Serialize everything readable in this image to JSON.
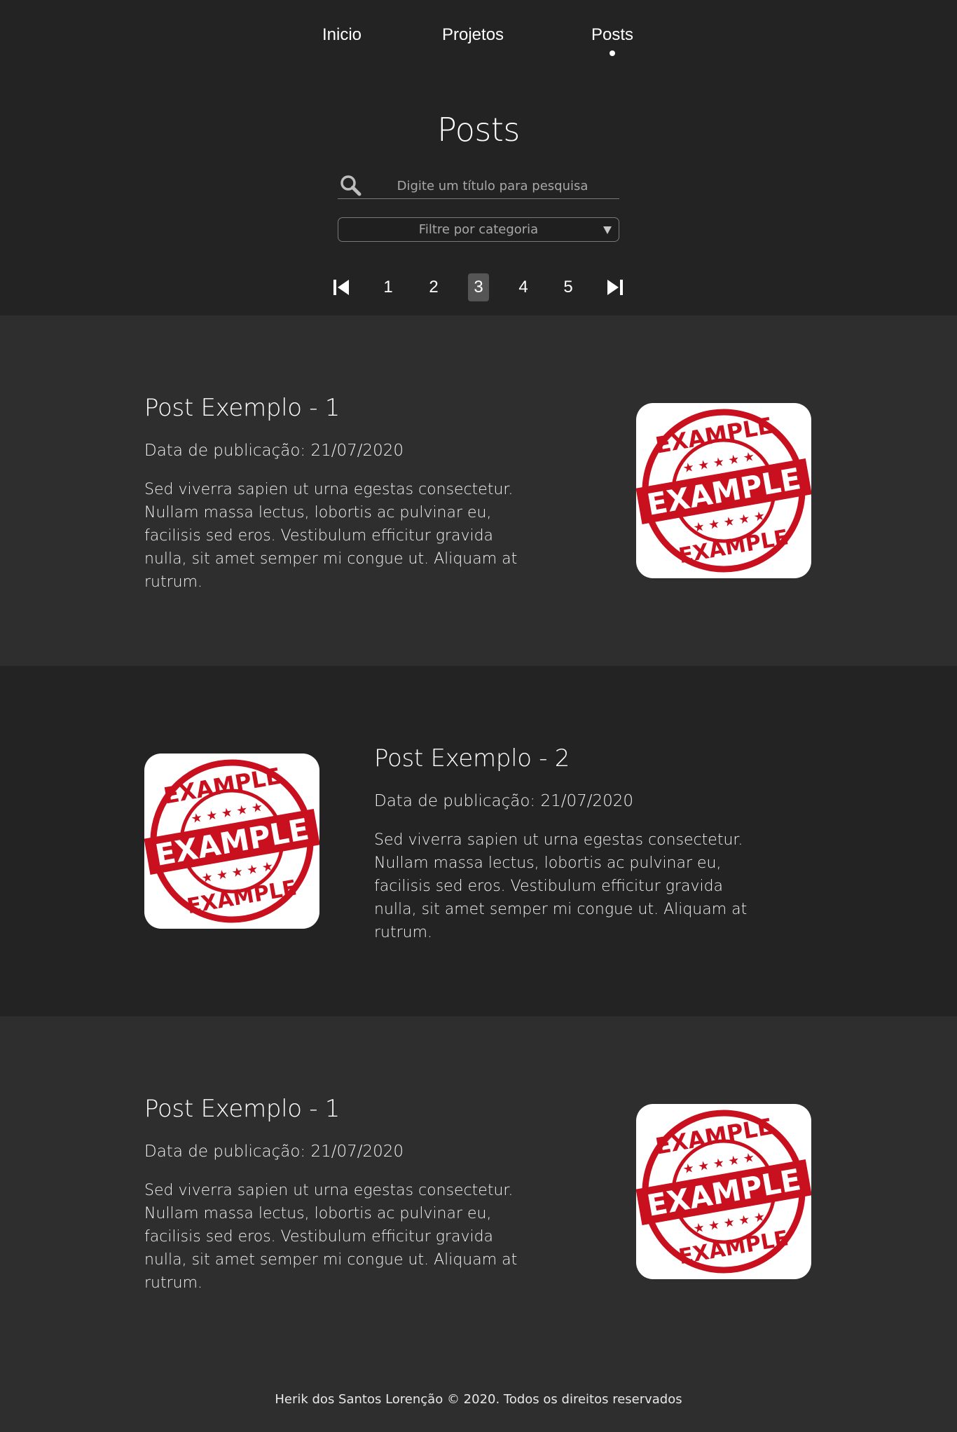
{
  "nav": {
    "items": [
      {
        "label": "Inicio"
      },
      {
        "label": "Projetos"
      },
      {
        "label": "Posts"
      }
    ],
    "active": "Posts"
  },
  "page": {
    "title": "Posts"
  },
  "search": {
    "placeholder": "Digite um título para pesquisa",
    "icon": "search-icon"
  },
  "category_filter": {
    "selected": "Filtre por categoria"
  },
  "pagination": {
    "pages": [
      "1",
      "2",
      "3",
      "4",
      "5"
    ],
    "current": "3",
    "first_icon": "first-page-icon",
    "last_icon": "last-page-icon"
  },
  "posts": [
    {
      "title": "Post Exemplo - 1",
      "date": "Data de publicação: 21/07/2020",
      "body": "Sed viverra sapien ut urna egestas consectetur. Nullam massa lectus, lobortis ac pulvinar eu, facilisis sed eros. Vestibulum efficitur gravida nulla, sit amet semper mi congue ut. Aliquam at rutrum.",
      "image_text": {
        "top": "EXAMPLE",
        "middle": "EXAMPLE",
        "bottom": "EXAMPLE"
      }
    },
    {
      "title": "Post Exemplo - 2",
      "date": "Data de publicação: 21/07/2020",
      "body": "Sed viverra sapien ut urna egestas consectetur. Nullam massa lectus, lobortis ac pulvinar eu, facilisis sed eros. Vestibulum efficitur gravida nulla, sit amet semper mi congue ut. Aliquam at rutrum.",
      "image_text": {
        "top": "EXAMPLE",
        "middle": "EXAMPLE",
        "bottom": "EXAMPLE"
      }
    },
    {
      "title": "Post Exemplo - 1",
      "date": "Data de publicação: 21/07/2020",
      "body": "Sed viverra sapien ut urna egestas consectetur. Nullam massa lectus, lobortis ac pulvinar eu, facilisis sed eros. Vestibulum efficitur gravida nulla, sit amet semper mi congue ut. Aliquam at rutrum.",
      "image_text": {
        "top": "EXAMPLE",
        "middle": "EXAMPLE",
        "bottom": "EXAMPLE"
      }
    }
  ],
  "footer": {
    "text": "Herik dos Santos Lorenção © 2020. Todos os direitos reservados"
  },
  "colors": {
    "background": "#232323",
    "alt_background": "#2e2e2e",
    "stamp_red": "#c8101e",
    "text": "#ffffff"
  }
}
